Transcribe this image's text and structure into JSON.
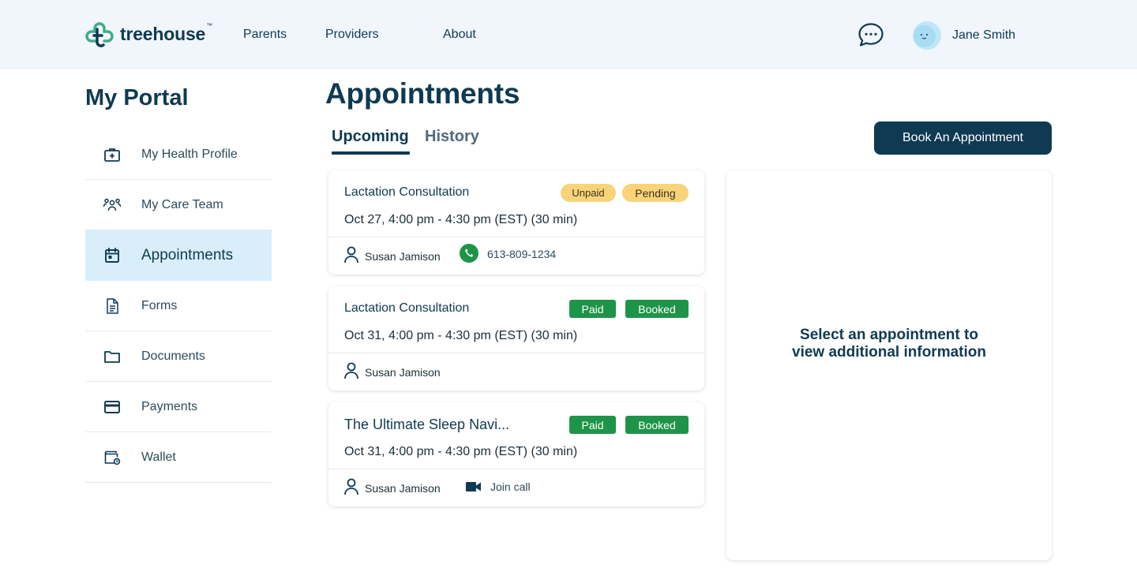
{
  "header": {
    "logo_text": "treehouse",
    "logo_tm": "™",
    "nav": [
      "Parents",
      "Providers",
      "About"
    ],
    "user_name": "Jane Smith"
  },
  "sidebar": {
    "title": "My Portal",
    "items": [
      {
        "label": "My Health Profile",
        "icon": "medical-kit-icon"
      },
      {
        "label": "My Care Team",
        "icon": "people-icon"
      },
      {
        "label": "Appointments",
        "icon": "calendar-icon",
        "active": true
      },
      {
        "label": "Forms",
        "icon": "document-icon"
      },
      {
        "label": "Documents",
        "icon": "folder-icon"
      },
      {
        "label": "Payments",
        "icon": "credit-card-icon"
      },
      {
        "label": "Wallet",
        "icon": "wallet-icon"
      }
    ]
  },
  "main": {
    "title": "Appointments",
    "tabs": [
      {
        "label": "Upcoming",
        "active": true
      },
      {
        "label": "History",
        "active": false
      }
    ],
    "book_button": "Book An Appointment",
    "appointments": [
      {
        "title": "Lactation Consultation",
        "time": "Oct 27, 4:00 pm - 4:30 pm (EST) (30 min)",
        "badges": [
          "Unpaid",
          "Pending"
        ],
        "provider": "Susan Jamison",
        "phone": "613-809-1234"
      },
      {
        "title": "Lactation Consultation",
        "time": "Oct 31, 4:00 pm - 4:30 pm (EST) (30 min)",
        "badges": [
          "Paid",
          "Booked"
        ],
        "provider": "Susan Jamison"
      },
      {
        "title": "The Ultimate Sleep Navi...",
        "time": "Oct 31, 4:00 pm - 4:30 pm (EST) (30 min)",
        "badges": [
          "Paid",
          "Booked"
        ],
        "provider": "Susan Jamison",
        "join_call": "Join call"
      }
    ],
    "detail_message_line1": "Select an appointment to",
    "detail_message_line2": "view additional information"
  },
  "colors": {
    "navy": "#0f3a52",
    "header_bg": "#f1f6fc",
    "active_bg": "#d8effb",
    "badge_yellow": "#f9d37a",
    "badge_green": "#1e9449",
    "phone_green": "#1e9449"
  }
}
